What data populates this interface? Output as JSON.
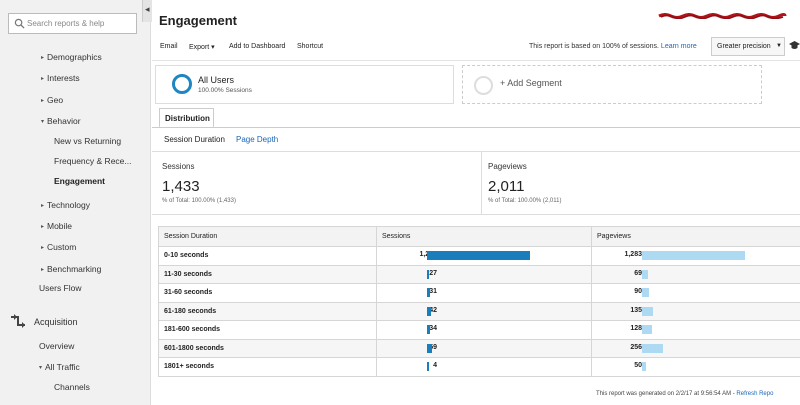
{
  "sidebar": {
    "search_placeholder": "Search reports & help",
    "items": [
      {
        "label": "Demographics",
        "caret": "▸"
      },
      {
        "label": "Interests",
        "caret": "▸"
      },
      {
        "label": "Geo",
        "caret": "▸"
      },
      {
        "label": "Behavior",
        "caret": "▾"
      },
      {
        "label": "New vs Returning"
      },
      {
        "label": "Frequency & Rece..."
      },
      {
        "label": "Engagement"
      },
      {
        "label": "Technology",
        "caret": "▸"
      },
      {
        "label": "Mobile",
        "caret": "▸"
      },
      {
        "label": "Custom",
        "caret": "▸"
      },
      {
        "label": "Benchmarking",
        "caret": "▸"
      },
      {
        "label": "Users Flow"
      },
      {
        "label": "Acquisition"
      },
      {
        "label": "Overview"
      },
      {
        "label": "All Traffic",
        "caret": "▾"
      },
      {
        "label": "Channels"
      }
    ],
    "active": "Engagement"
  },
  "header": {
    "title": "Engagement",
    "toolbar": {
      "email": "Email",
      "export": "Export ▾",
      "add_dashboard": "Add to Dashboard",
      "shortcut": "Shortcut"
    },
    "report_note": "This report is based on 100% of sessions.",
    "learn_more": "Learn more",
    "precision": "Greater precision"
  },
  "segments": {
    "active": {
      "name": "All Users",
      "sub": "100.00% Sessions"
    },
    "add_label": "+ Add Segment"
  },
  "tabs": {
    "distribution": "Distribution",
    "subtabs": [
      "Session Duration",
      "Page Depth"
    ]
  },
  "summary": {
    "sessions": {
      "label": "Sessions",
      "value": "1,433",
      "sub": "% of Total: 100.00% (1,433)"
    },
    "pageviews": {
      "label": "Pageviews",
      "value": "2,011",
      "sub": "% of Total: 100.00% (2,011)"
    }
  },
  "table": {
    "headers": [
      "Session Duration",
      "Sessions",
      "Pageviews"
    ],
    "rows": [
      {
        "duration": "0-10 seconds",
        "sessions": "1,236",
        "pageviews": "1,283"
      },
      {
        "duration": "11-30 seconds",
        "sessions": "27",
        "pageviews": "69"
      },
      {
        "duration": "31-60 seconds",
        "sessions": "31",
        "pageviews": "90"
      },
      {
        "duration": "61-180 seconds",
        "sessions": "42",
        "pageviews": "135"
      },
      {
        "duration": "181-600 seconds",
        "sessions": "34",
        "pageviews": "128"
      },
      {
        "duration": "601-1800 seconds",
        "sessions": "59",
        "pageviews": "256"
      },
      {
        "duration": "1801+ seconds",
        "sessions": "4",
        "pageviews": "50"
      }
    ]
  },
  "footer": {
    "generated": "This report was generated on 2/2/17 at 9:56:54 AM -",
    "refresh": "Refresh Repo"
  },
  "colors": {
    "sessions_bar": "#1a7ebc",
    "pageviews_bar": "#aed9f3",
    "link": "#1a66b8",
    "redaction": "#b0141b"
  }
}
